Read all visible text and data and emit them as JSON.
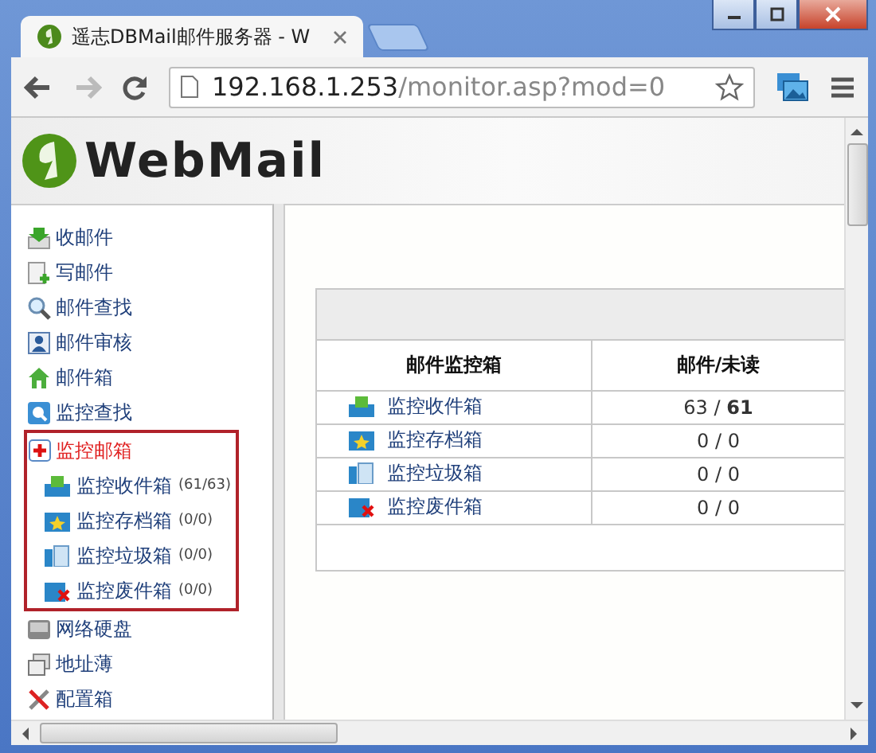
{
  "browser": {
    "tab": {
      "title": "遥志DBMail邮件服务器 - W",
      "selected": true
    },
    "address": {
      "host": "192.168.1.253",
      "path": "/monitor.asp?mod=0"
    }
  },
  "logo": {
    "text": "WebMail"
  },
  "sidebar": {
    "items": [
      {
        "label": "收邮件",
        "kind": "receive",
        "selected": false
      },
      {
        "label": "写邮件",
        "kind": "compose",
        "selected": false
      },
      {
        "label": "邮件查找",
        "kind": "search",
        "selected": false
      },
      {
        "label": "邮件审核",
        "kind": "review",
        "selected": false
      },
      {
        "label": "邮件箱",
        "kind": "home",
        "selected": false
      },
      {
        "label": "监控查找",
        "kind": "monitor-search",
        "selected": false
      },
      {
        "label": "监控邮箱",
        "kind": "monitor",
        "selected": true,
        "children": [
          {
            "label": "监控收件箱",
            "count": "(61/63)",
            "kind": "inbox"
          },
          {
            "label": "监控存档箱",
            "count": "(0/0)",
            "kind": "archive"
          },
          {
            "label": "监控垃圾箱",
            "count": "(0/0)",
            "kind": "trash"
          },
          {
            "label": "监控废件箱",
            "count": "(0/0)",
            "kind": "junk"
          }
        ]
      },
      {
        "label": "网络硬盘",
        "kind": "disk",
        "selected": false
      },
      {
        "label": "地址薄",
        "kind": "address",
        "selected": false
      },
      {
        "label": "配置箱",
        "kind": "tools",
        "selected": false
      }
    ]
  },
  "table": {
    "columns": [
      "邮件监控箱",
      "邮件/未读"
    ],
    "rows": [
      {
        "name": "监控收件箱",
        "kind": "inbox",
        "counts": "63 / **61**"
      },
      {
        "name": "监控存档箱",
        "kind": "archive",
        "counts": "0 / 0"
      },
      {
        "name": "监控垃圾箱",
        "kind": "trash",
        "counts": "0 / 0"
      },
      {
        "name": "监控废件箱",
        "kind": "junk",
        "counts": "0 / 0"
      }
    ]
  }
}
